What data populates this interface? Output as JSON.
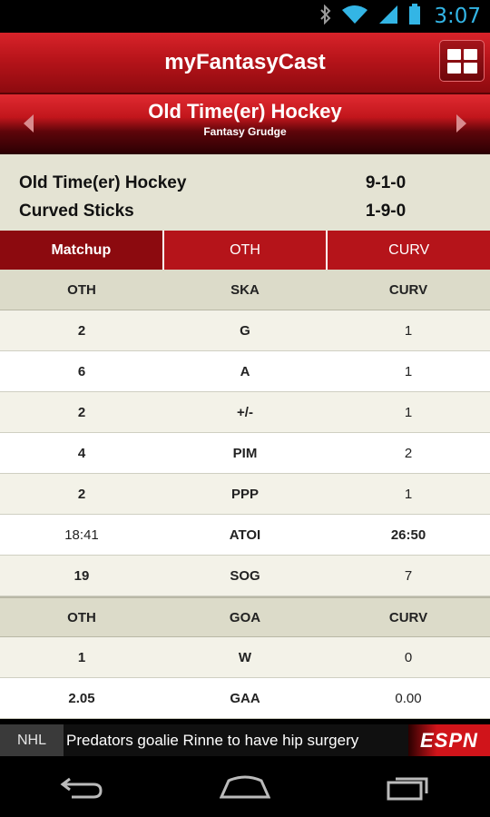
{
  "status": {
    "time": "3:07"
  },
  "app": {
    "title": "myFantasyCast"
  },
  "league": {
    "name": "Old Time(er) Hockey",
    "subtitle": "Fantasy Grudge"
  },
  "records": [
    {
      "team": "Old Time(er) Hockey",
      "record": "9-1-0"
    },
    {
      "team": "Curved Sticks",
      "record": "1-9-0"
    }
  ],
  "tabs": [
    "Matchup",
    "OTH",
    "CURV"
  ],
  "skaters": {
    "header": [
      "OTH",
      "SKA",
      "CURV"
    ],
    "rows": [
      {
        "left": "2",
        "stat": "G",
        "right": "1"
      },
      {
        "left": "6",
        "stat": "A",
        "right": "1"
      },
      {
        "left": "2",
        "stat": "+/-",
        "right": "1"
      },
      {
        "left": "4",
        "stat": "PIM",
        "right": "2"
      },
      {
        "left": "2",
        "stat": "PPP",
        "right": "1"
      },
      {
        "left": "18:41",
        "stat": "ATOI",
        "right": "26:50"
      },
      {
        "left": "19",
        "stat": "SOG",
        "right": "7"
      }
    ]
  },
  "goalies": {
    "header": [
      "OTH",
      "GOA",
      "CURV"
    ],
    "rows": [
      {
        "left": "1",
        "stat": "W",
        "right": "0"
      },
      {
        "left": "2.05",
        "stat": "GAA",
        "right": "0.00"
      }
    ]
  },
  "ticker": {
    "league": "NHL",
    "headline": "Predators goalie Rinne to have hip surgery",
    "brand": "ESPN"
  }
}
